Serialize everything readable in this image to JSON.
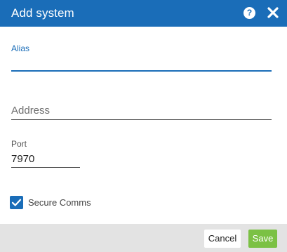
{
  "dialog": {
    "title": "Add system",
    "help_glyph": "?",
    "help_icon": "question-circle-icon",
    "close_icon": "close-x-icon"
  },
  "form": {
    "alias": {
      "label": "Alias",
      "value": ""
    },
    "address": {
      "placeholder": "Address",
      "value": ""
    },
    "port": {
      "label": "Port",
      "value": "7970"
    },
    "secure_comms": {
      "label": "Secure Comms",
      "checked": true
    }
  },
  "footer": {
    "cancel_label": "Cancel",
    "save_label": "Save"
  },
  "colors": {
    "accent": "#1a6db8",
    "save": "#7bc144",
    "footer_bg": "#e3e3e3"
  }
}
